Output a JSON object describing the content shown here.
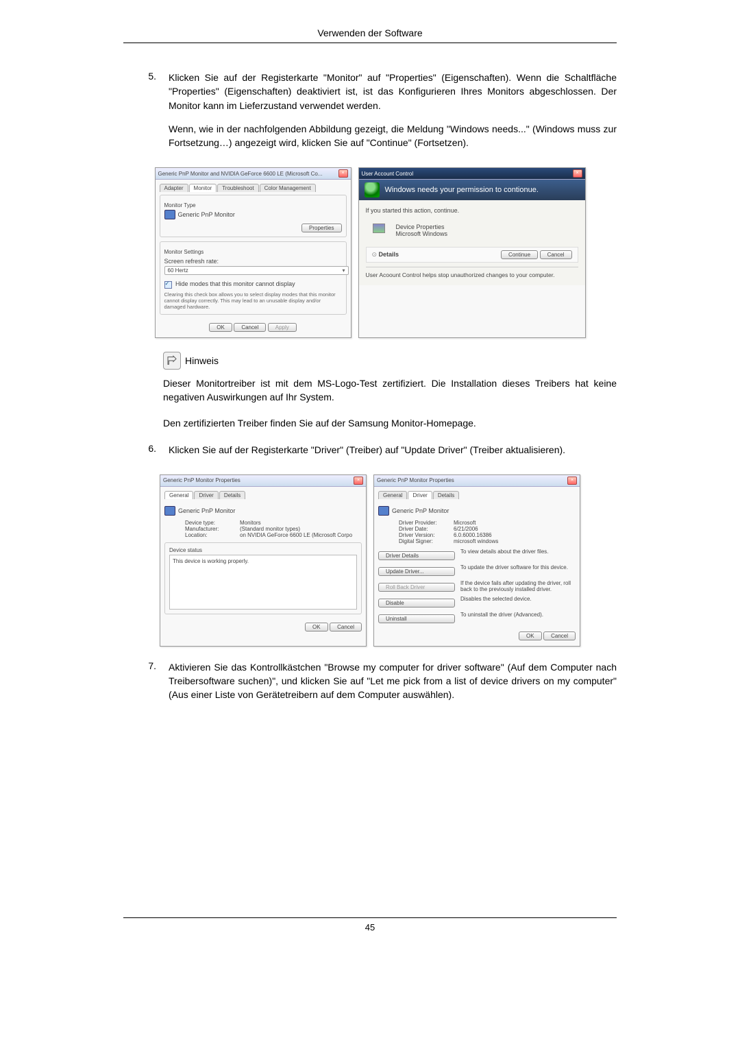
{
  "header": {
    "title": "Verwenden der Software"
  },
  "step5": {
    "num": "5.",
    "p1": "Klicken Sie auf der Registerkarte \"Monitor\" auf \"Properties\" (Eigenschaften). Wenn die Schaltfläche \"Properties\" (Eigenschaften) deaktiviert ist, ist das Konfigurieren Ihres Monitors abgeschlossen. Der Monitor kann im Lieferzustand verwendet werden.",
    "p2": "Wenn, wie in der nachfolgenden Abbildung gezeigt, die Meldung \"Windows needs...\" (Windows muss zur Fortsetzung…) angezeigt wird, klicken Sie auf \"Continue\" (Fortsetzen)."
  },
  "monitorDialog": {
    "title": "Generic PnP Monitor and NVIDIA GeForce 6600 LE (Microsoft Co...",
    "tabs": [
      "Adapter",
      "Monitor",
      "Troubleshoot",
      "Color Management"
    ],
    "monitorTypeLabel": "Monitor Type",
    "monitorName": "Generic PnP Monitor",
    "propertiesBtn": "Properties",
    "settingsLabel": "Monitor Settings",
    "refreshLabel": "Screen refresh rate:",
    "refreshValue": "60 Hertz",
    "hideModes": "Hide modes that this monitor cannot display",
    "hideModesHelp": "Clearing this check box allows you to select display modes that this monitor cannot display correctly. This may lead to an unusable display and/or damaged hardware.",
    "ok": "OK",
    "cancel": "Cancel",
    "apply": "Apply"
  },
  "uacDialog": {
    "title": "User Account Control",
    "heading": "Windows needs your permission to contionue.",
    "startedLine": "If you started this action, continue.",
    "devProps": "Device Properties",
    "msWindows": "Microsoft Windows",
    "details": "Details",
    "continue": "Continue",
    "cancel": "Cancel",
    "footer": "User Acoount Control helps stop unauthorized changes to your computer."
  },
  "hinweis": {
    "label": "Hinweis",
    "p1": "Dieser Monitortreiber ist mit dem MS-Logo-Test zertifiziert. Die Installation dieses Treibers hat keine negativen Auswirkungen auf Ihr System.",
    "p2": "Den zertifizierten Treiber finden Sie auf der Samsung Monitor-Homepage."
  },
  "step6": {
    "num": "6.",
    "text": "Klicken Sie auf der Registerkarte \"Driver\" (Treiber) auf \"Update Driver\" (Treiber aktualisieren)."
  },
  "genDialog": {
    "title": "Generic PnP Monitor Properties",
    "tabs": [
      "General",
      "Driver",
      "Details"
    ],
    "monitorName": "Generic PnP Monitor",
    "g": {
      "devtypeLbl": "Device type:",
      "devtype": "Monitors",
      "mfrLbl": "Manufacturer:",
      "mfr": "(Standard monitor types)",
      "locLbl": "Location:",
      "loc": "on NVIDIA GeForce 6600 LE (Microsoft Corpo",
      "statusLbl": "Device status",
      "status": "This device is working properly."
    },
    "ok": "OK",
    "cancel": "Cancel"
  },
  "drvDialog": {
    "title": "Generic PnP Monitor Properties",
    "monitorName": "Generic PnP Monitor",
    "provLbl": "Driver Provider:",
    "prov": "Microsoft",
    "dateLbl": "Driver Date:",
    "date": "6/21/2006",
    "verLbl": "Driver Version:",
    "ver": "6.0.6000.16386",
    "signLbl": "Digital Signer:",
    "sign": "microsoft windows",
    "btnDetails": "Driver Details",
    "btnDetailsTxt": "To view details about the driver files.",
    "btnUpdate": "Update Driver...",
    "btnUpdateTxt": "To update the driver software for this device.",
    "btnRoll": "Roll Back Driver",
    "btnRollTxt": "If the device fails after updating the driver, roll back to the previously installed driver.",
    "btnDisable": "Disable",
    "btnDisableTxt": "Disables the selected device.",
    "btnUninstall": "Uninstall",
    "btnUninstallTxt": "To uninstall the driver (Advanced).",
    "ok": "OK",
    "cancel": "Cancel"
  },
  "step7": {
    "num": "7.",
    "text": "Aktivieren Sie das Kontrollkästchen \"Browse my computer for driver software\" (Auf dem Computer nach Treibersoftware suchen)\", und klicken Sie auf \"Let me pick from a list of device drivers on my computer\" (Aus einer Liste von Gerätetreibern auf dem Computer auswählen)."
  },
  "pageNum": "45"
}
